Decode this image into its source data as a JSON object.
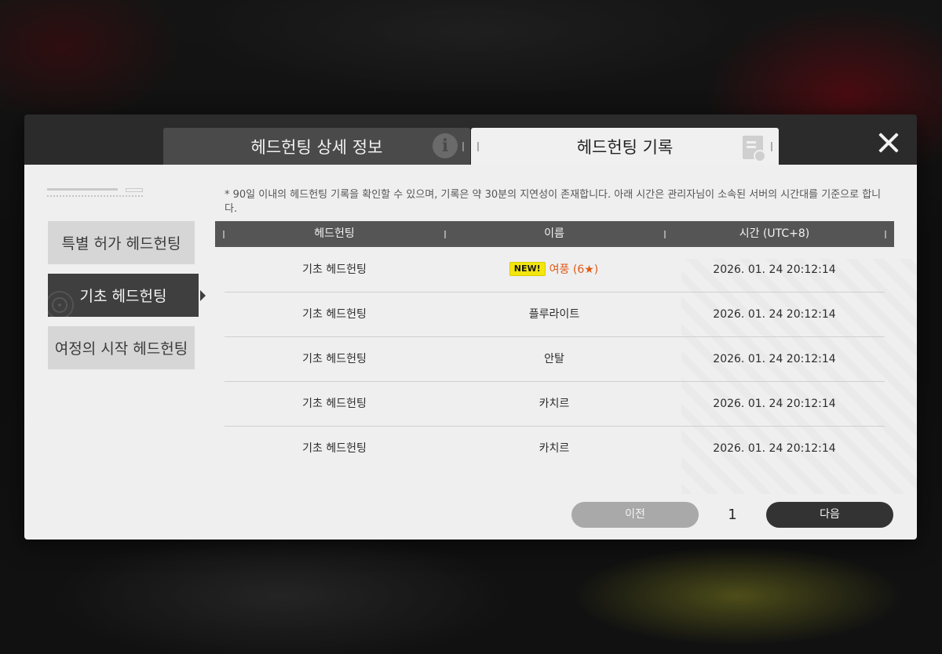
{
  "tabs": {
    "detail_label": "헤드헌팅 상세 정보",
    "record_label": "헤드헌팅 기록",
    "info_icon": "info-icon",
    "record_icon": "document-icon"
  },
  "close_icon": "close-icon",
  "nav": {
    "items": [
      {
        "label": "특별 허가 헤드헌팅",
        "selected": false
      },
      {
        "label": "기초 헤드헌팅",
        "selected": true
      },
      {
        "label": "여정의 시작 헤드헌팅",
        "selected": false
      }
    ]
  },
  "notice": "* 90일 이내의 헤드헌팅 기록을 확인할 수 있으며, 기록은 약 30분의 지연성이 존재합니다. 아래 시간은 관리자님이 소속된 서버의 시간대를 기준으로 합니다.",
  "table": {
    "headers": [
      "헤드헌팅",
      "이름",
      "시간 (UTC+8)"
    ],
    "rows": [
      {
        "type": "기초 헤드헌팅",
        "badge": "NEW!",
        "name": "여풍 (6★)",
        "time": "2026. 01. 24 20:12:14"
      },
      {
        "type": "기초 헤드헌팅",
        "badge": "",
        "name": "플루라이트",
        "time": "2026. 01. 24 20:12:14"
      },
      {
        "type": "기초 헤드헌팅",
        "badge": "",
        "name": "안탈",
        "time": "2026. 01. 24 20:12:14"
      },
      {
        "type": "기초 헤드헌팅",
        "badge": "",
        "name": "카치르",
        "time": "2026. 01. 24 20:12:14"
      },
      {
        "type": "기초 헤드헌팅",
        "badge": "",
        "name": "카치르",
        "time": "2026. 01. 24 20:12:14"
      }
    ]
  },
  "pagination": {
    "prev_label": "이전",
    "page": "1",
    "next_label": "다음"
  },
  "colors": {
    "new_name": "#e05a14",
    "new_badge": "#f3e60e",
    "selected_nav": "#3f3f3f"
  }
}
